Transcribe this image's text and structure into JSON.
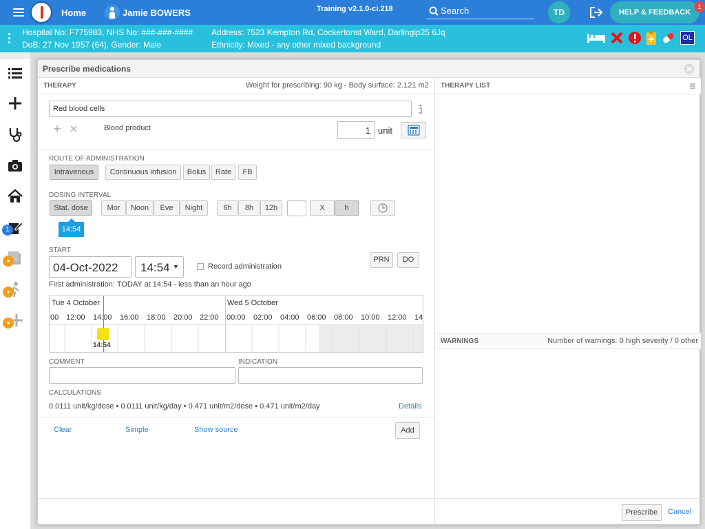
{
  "topbar": {
    "home_label": "Home",
    "patient_name": "Jamie BOWERS",
    "version": "Training v2.1.0-ci.218",
    "search_label": "Search",
    "user_initials": "TD",
    "help_label": "HELP & FEEDBACK",
    "help_badge": "1"
  },
  "patient": {
    "line1_left": "Hospital No: F775983, NHS No: ###-###-####",
    "line1_right": "Address: 7523 Kempton Rd, Cockertonst Ward, Darlingip25 6Jq",
    "line2_left": "DoB: 27 Nov 1957 (64), Gender: Male",
    "line2_right": "Ethnicity: Mixed - any other mixed background",
    "ol_badge": "OL"
  },
  "sidebar": {
    "pending_count": "1"
  },
  "dialog": {
    "title": "Prescribe medications",
    "therapy_header": "THERAPY",
    "weight_info": "Weight for prescribing: 90 kg - Body surface: 2.121 m2",
    "therapy_list_header": "THERAPY LIST",
    "warnings_header": "WARNINGS",
    "warnings_info": "Number of warnings: 0 high severity / 0 other",
    "medication": "Red blood cells",
    "product_type": "Blood product",
    "dose_value": "1",
    "dose_unit": "unit",
    "route_label": "ROUTE OF ADMINISTRATION",
    "routes": [
      "Intravenous",
      "Continuous infusion",
      "Bolus",
      "Rate",
      "FB"
    ],
    "dosing_label": "DOSING INTERVAL",
    "stat_dose": "Stat. dose",
    "times": [
      "Mor",
      "Noon",
      "Eve",
      "Night"
    ],
    "intervals": [
      "6h",
      "8h",
      "12h"
    ],
    "x_label": "X",
    "h_label": "h",
    "stat_time": "14:54",
    "start_label": "START",
    "start_date": "04-Oct-2022",
    "start_time": "14:54",
    "record_admin": "Record administration",
    "prn": "PRN",
    "do": "DO",
    "first_admin": "First administration: TODAY at 14:54 - less than an hour ago",
    "timeline": {
      "day1": "Tue 4 October",
      "day2": "Wed 5 October",
      "hours": [
        "00",
        "12:00",
        "14:00",
        "16:00",
        "18:00",
        "20:00",
        "22:00",
        "00:00",
        "02:00",
        "04:00",
        "06:00",
        "08:00",
        "10:00",
        "12:00",
        "14"
      ],
      "marker_time": "14:54"
    },
    "comment_label": "COMMENT",
    "indication_label": "INDICATION",
    "calc_label": "CALCULATIONS",
    "calculations": "0.0111 unit/kg/dose • 0.0111 unit/kg/day • 0.471 unit/m2/dose • 0.471 unit/m2/day",
    "details": "Details",
    "clear": "Clear",
    "simple": "Simple",
    "show_source": "Show source",
    "add": "Add",
    "prescribe": "Prescribe",
    "cancel": "Cancel"
  },
  "colors": {
    "topbar": "#2b7fd9",
    "patient_bar": "#29c0dd",
    "accent": "#2fb0bf",
    "tooltip": "#1e9fe0",
    "marker": "#f5e11a"
  }
}
